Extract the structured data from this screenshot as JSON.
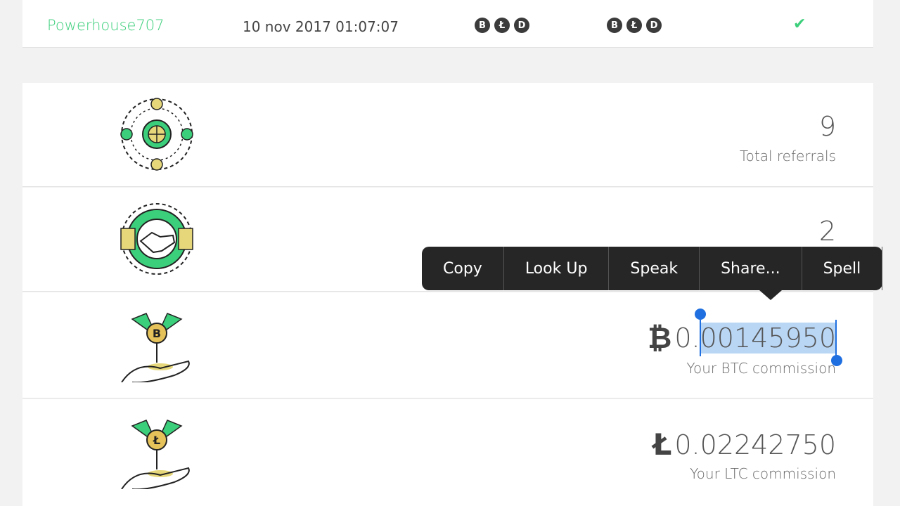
{
  "top_row": {
    "username": "Powerhouse707",
    "timestamp": "10 nov 2017 01:07:07",
    "coins_a": [
      "B",
      "Ł",
      "D"
    ],
    "coins_b": [
      "B",
      "Ł",
      "D"
    ],
    "status_icon": "check-icon"
  },
  "stats": [
    {
      "value": "9",
      "label": "Total referrals",
      "icon": "referral-network-icon"
    },
    {
      "value": "2",
      "label": "",
      "icon": "handshake-icon"
    },
    {
      "symbol": "₿",
      "value_prefix": "0.",
      "value_selected": "00145950",
      "label": "Your BTC commission",
      "icon": "bitcoin-plant-icon"
    },
    {
      "symbol": "Ł",
      "value": "0.02242750",
      "label": "Your LTC commission",
      "icon": "litecoin-plant-icon"
    }
  ],
  "context_menu": {
    "items": [
      "Copy",
      "Look Up",
      "Speak",
      "Share...",
      "Spell"
    ]
  },
  "colors": {
    "accent": "#3ccf7b",
    "selection": "#b9d6f5",
    "menu_bg": "#262626"
  }
}
